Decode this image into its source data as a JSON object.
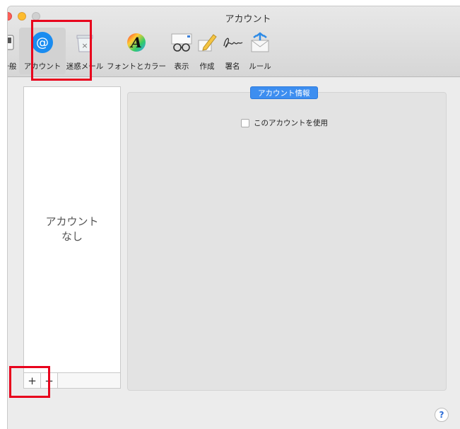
{
  "window": {
    "title": "アカウント"
  },
  "toolbar": {
    "items": [
      {
        "label": "一般",
        "icon": "switch-icon"
      },
      {
        "label": "アカウント",
        "icon": "at-sign-icon",
        "selected": true
      },
      {
        "label": "迷惑メール",
        "icon": "trash-junk-icon"
      },
      {
        "label": "フォントとカラー",
        "icon": "font-color-icon"
      },
      {
        "label": "表示",
        "icon": "glasses-icon"
      },
      {
        "label": "作成",
        "icon": "pencil-icon"
      },
      {
        "label": "署名",
        "icon": "signature-icon"
      },
      {
        "label": "ルール",
        "icon": "rules-envelope-icon"
      }
    ]
  },
  "accounts": {
    "empty_line1": "アカウント",
    "empty_line2": "なし",
    "add_label": "+",
    "remove_label": "−"
  },
  "detail": {
    "tab_label": "アカウント情報",
    "use_account_label": "このアカウントを使用",
    "use_account_checked": false
  },
  "help": {
    "label": "?"
  },
  "colors": {
    "highlight": "#e8001c",
    "accent": "#3d8ef0"
  }
}
